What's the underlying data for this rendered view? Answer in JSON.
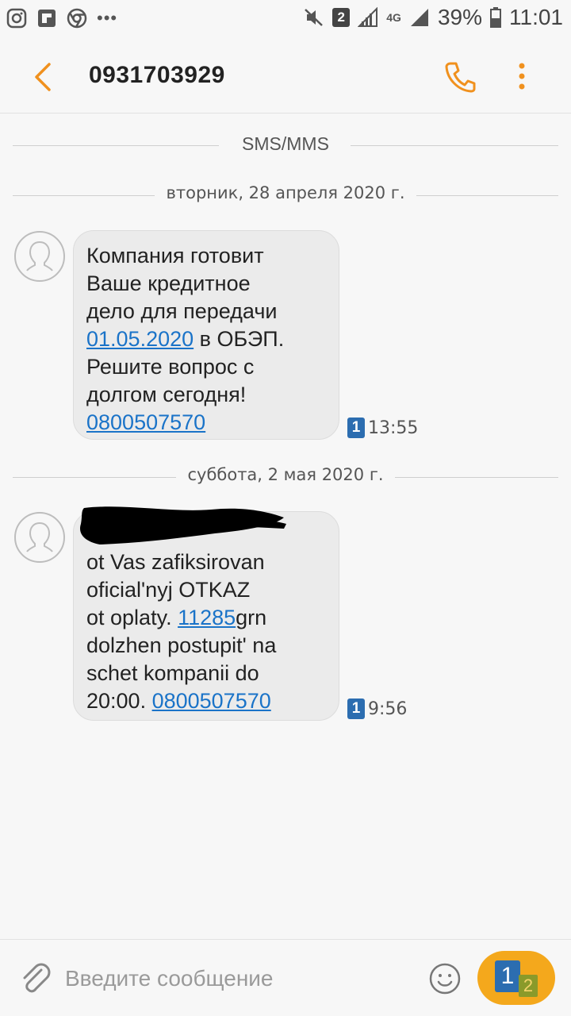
{
  "status_bar": {
    "battery_percent": "39%",
    "time": "11:01",
    "sim_badge": "2",
    "network": "4G",
    "icons": [
      "instagram-icon",
      "flipboard-icon",
      "chrome-icon",
      "more-dots-icon",
      "mute-icon",
      "signal-icon",
      "battery-icon"
    ]
  },
  "header": {
    "title": "0931703929",
    "accent_color": "#f0911e"
  },
  "thread": {
    "channel_label": "SMS/MMS",
    "groups": [
      {
        "date": "вторник, 28 апреля 2020 г.",
        "message": {
          "line1": "Компания готовит",
          "line2": "Ваше кредитное",
          "line3": "дело для передачи",
          "link_date": "01.05.2020",
          "line4_rest": " в ОБЭП.",
          "line5": "Решите вопрос с",
          "line6": "долгом сегодня!",
          "link_phone": "0800507570",
          "sim": "1",
          "time": "13:55"
        }
      },
      {
        "date": "суббота, 2 мая 2020 г.",
        "message": {
          "line1": "ot Vas zafiksirovan",
          "line2": "oficial'nyj OTKAZ",
          "line3_pre": "ot oplaty. ",
          "link_amount": "11285",
          "line3_post": "grn",
          "line4": "dolzhen postupit' na",
          "line5": "schet kompanii do",
          "line6_pre": "20:00. ",
          "link_phone": "0800507570",
          "sim": "1",
          "time": "9:56"
        }
      }
    ]
  },
  "composer": {
    "placeholder": "Введите сообщение",
    "send_sim_primary": "1",
    "send_sim_secondary": "2",
    "send_color": "#f4a81c"
  }
}
